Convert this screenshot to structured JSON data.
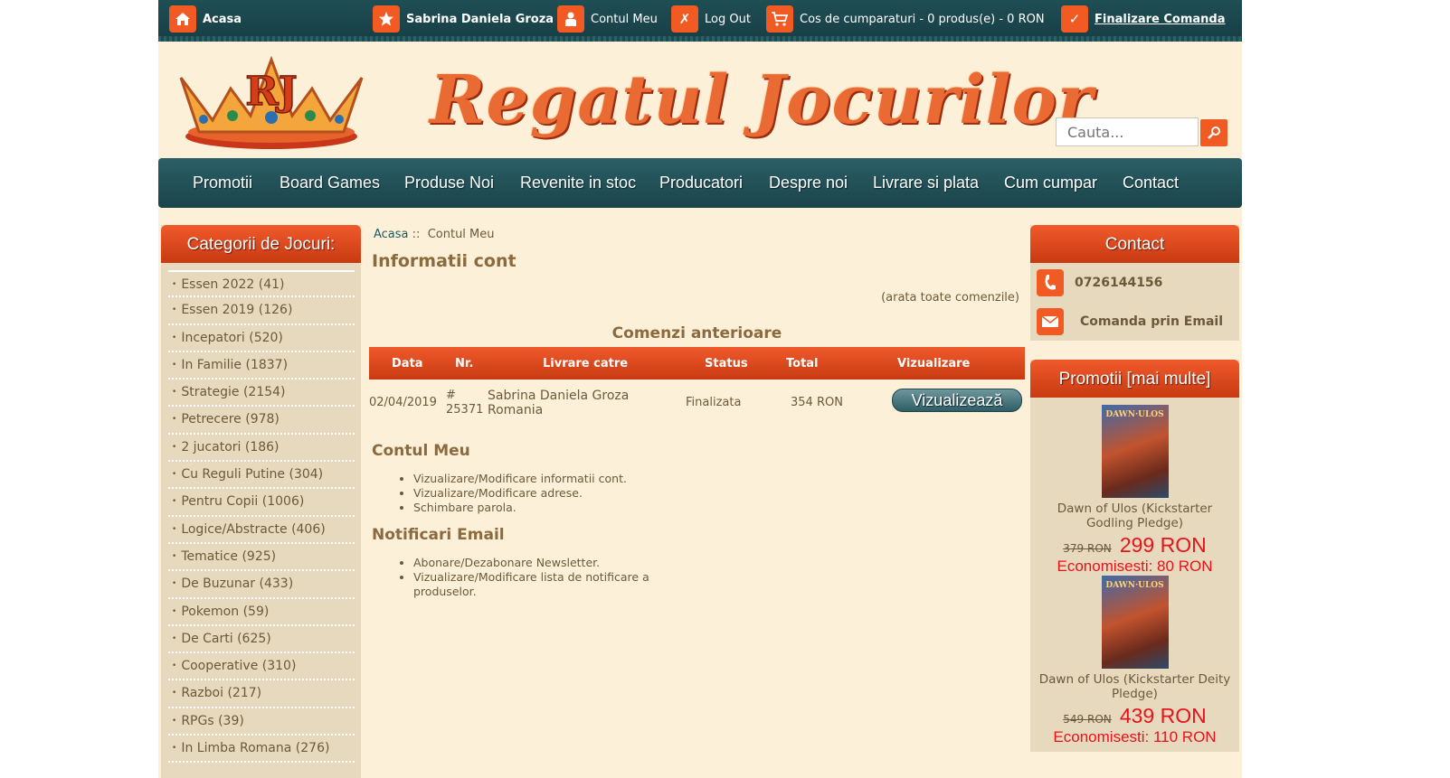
{
  "topbar": {
    "home": "Acasa",
    "user": "Sabrina Daniela Groza",
    "account": "Contul Meu",
    "logout": "Log Out",
    "cart": "Cos de cumparaturi - 0 produs(e) - 0 RON",
    "checkout": "Finalizare Comanda"
  },
  "header": {
    "logo_text": "RJ",
    "brand": "Regatul Jocurilor",
    "search_placeholder": "Cauta..."
  },
  "nav": [
    "Promotii",
    "Board Games",
    "Produse Noi",
    "Revenite in stoc",
    "Producatori",
    "Despre noi",
    "Livrare si plata",
    "Cum cumpar",
    "Contact"
  ],
  "categories": {
    "title": "Categorii de Jocuri:",
    "items": [
      "Essen 2022 (41)",
      "Essen 2019 (126)",
      "Incepatori (520)",
      "In Familie (1837)",
      "Strategie (2154)",
      "Petrecere (978)",
      "2 jucatori (186)",
      "Cu Reguli Putine (304)",
      "Pentru Copii (1006)",
      "Logice/Abstracte (406)",
      "Tematice (925)",
      "De Buzunar (433)",
      "Pokemon (59)",
      "De Carti (625)",
      "Cooperative (310)",
      "Razboi (217)",
      "RPGs (39)",
      "In Limba Romana (276)"
    ]
  },
  "breadcrumb": {
    "home": "Acasa",
    "sep": "::",
    "current": "Contul Meu"
  },
  "main": {
    "title": "Informatii cont",
    "show_all": "(arata toate comenzile)",
    "orders_title": "Comenzi anterioare",
    "orders_headers": [
      "Data",
      "Nr.",
      "Livrare catre",
      "Status",
      "Total",
      "Vizualizare"
    ],
    "orders": [
      {
        "date": "02/04/2019",
        "nr_prefix": "#",
        "nr": "25371",
        "name": "Sabrina Daniela Groza",
        "country": "Romania",
        "status": "Finalizata",
        "total": "354 RON",
        "view": "Vizualizează"
      }
    ],
    "account_title": "Contul Meu",
    "account_links": [
      "Vizualizare/Modificare informatii cont.",
      "Vizualizare/Modificare adrese.",
      "Schimbare parola."
    ],
    "notif_title": "Notificari Email",
    "notif_links": [
      "Abonare/Dezabonare Newsletter.",
      "Vizualizare/Modificare lista de notificare a produselor."
    ]
  },
  "contact": {
    "title": "Contact",
    "phone": "0726144156",
    "email": "Comanda prin Email"
  },
  "promo": {
    "title": "Promotii  [mai multe]",
    "items": [
      {
        "cover_text": "DAWN·ULOS",
        "name": "Dawn of Ulos (Kickstarter Godling Pledge)",
        "old": "379 RON",
        "new": "299 RON",
        "save": "Economisesti: 80 RON"
      },
      {
        "cover_text": "DAWN·ULOS",
        "name": "Dawn of Ulos (Kickstarter Deity Pledge)",
        "old": "549 RON",
        "new": "439 RON",
        "save": "Economisesti: 110 RON"
      }
    ]
  },
  "colors": {
    "accent": "#f15a22",
    "teal": "#1f4e55",
    "panel": "#e7d9bd",
    "page_bg": "#fdf0d8",
    "price_red": "#e8121b"
  },
  "icons": {
    "home": "home-icon",
    "user": "star-icon",
    "account": "person-icon",
    "logout": "x-icon",
    "cart": "cart-icon",
    "checkout": "check-icon",
    "search": "search-icon",
    "phone": "phone-icon",
    "email": "envelope-icon"
  }
}
